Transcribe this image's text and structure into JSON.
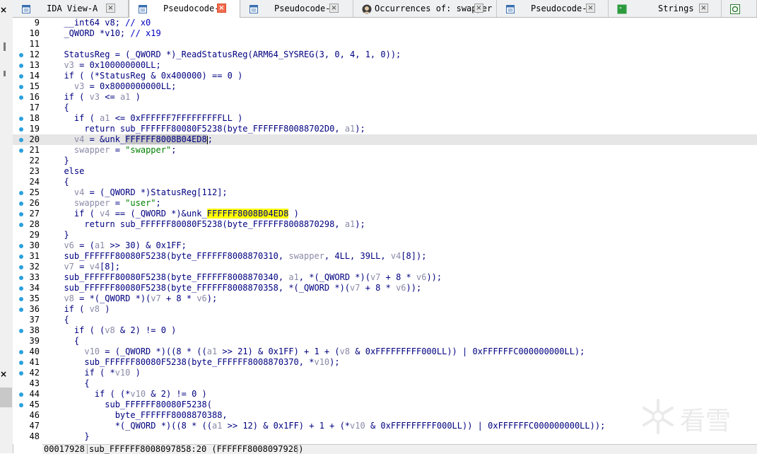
{
  "tabs": [
    {
      "label": "IDA View-A",
      "icon": "text-view-icon",
      "active": false
    },
    {
      "label": "Pseudocode-C",
      "icon": "pseudocode-icon",
      "active": true
    },
    {
      "label": "Pseudocode-B",
      "icon": "pseudocode-icon",
      "active": false
    },
    {
      "label": "Occurrences of: swapper",
      "icon": "avatar-icon",
      "active": false
    },
    {
      "label": "Pseudocode-A",
      "icon": "pseudocode-icon",
      "active": false
    },
    {
      "label": "Strings",
      "icon": "strings-icon",
      "active": false
    },
    {
      "label": "",
      "icon": "function-icon",
      "active": false
    }
  ],
  "close_glyph": "×",
  "code_lines": [
    {
      "n": "9",
      "dot": false,
      "parts": [
        [
          "t",
          "  __int64 v8; "
        ],
        [
          "cmt",
          "// x0"
        ]
      ]
    },
    {
      "n": "10",
      "dot": false,
      "parts": [
        [
          "t",
          "  _QWORD *v10; "
        ],
        [
          "cmt",
          "// x19"
        ]
      ]
    },
    {
      "n": "11",
      "dot": false,
      "parts": []
    },
    {
      "n": "12",
      "dot": true,
      "parts": [
        [
          "t",
          "  StatusReg = (_QWORD *)_ReadStatusReg(ARM64_SYSREG(3, 0, 4, 1, 0));"
        ]
      ]
    },
    {
      "n": "13",
      "dot": true,
      "parts": [
        [
          "var",
          "  v3"
        ],
        [
          "t",
          " = 0x100000000LL;"
        ]
      ]
    },
    {
      "n": "14",
      "dot": true,
      "parts": [
        [
          "t",
          "  if ( (*StatusReg & 0x400000) == 0 )"
        ]
      ]
    },
    {
      "n": "15",
      "dot": true,
      "parts": [
        [
          "var",
          "    v3"
        ],
        [
          "t",
          " = 0x8000000000LL;"
        ]
      ]
    },
    {
      "n": "16",
      "dot": true,
      "parts": [
        [
          "t",
          "  if ( "
        ],
        [
          "var",
          "v3"
        ],
        [
          "t",
          " <= "
        ],
        [
          "var",
          "a1"
        ],
        [
          "t",
          " )"
        ]
      ]
    },
    {
      "n": "17",
      "dot": false,
      "parts": [
        [
          "t",
          "  {"
        ]
      ]
    },
    {
      "n": "18",
      "dot": true,
      "parts": [
        [
          "t",
          "    if ( "
        ],
        [
          "var",
          "a1"
        ],
        [
          "t",
          " <= 0xFFFFFF7FFFFFFFFFLL )"
        ]
      ]
    },
    {
      "n": "19",
      "dot": true,
      "parts": [
        [
          "t",
          "      return sub_FFFFFF80080F5238(byte_FFFFFF80088702D0, "
        ],
        [
          "var",
          "a1"
        ],
        [
          "t",
          ");"
        ]
      ]
    },
    {
      "n": "20",
      "dot": true,
      "cur": true,
      "parts": [
        [
          "var",
          "    v4"
        ],
        [
          "t",
          " = &unk_"
        ],
        [
          "sel",
          "FFFFFF8008B04ED8"
        ],
        [
          "caret",
          ""
        ],
        [
          "t",
          ";"
        ]
      ]
    },
    {
      "n": "21",
      "dot": true,
      "parts": [
        [
          "var",
          "    swapper"
        ],
        [
          "t",
          " = "
        ],
        [
          "str",
          "\"swapper\""
        ],
        [
          "t",
          ";"
        ]
      ]
    },
    {
      "n": "22",
      "dot": false,
      "parts": [
        [
          "t",
          "  }"
        ]
      ]
    },
    {
      "n": "23",
      "dot": false,
      "parts": [
        [
          "t",
          "  else"
        ]
      ]
    },
    {
      "n": "24",
      "dot": false,
      "parts": [
        [
          "t",
          "  {"
        ]
      ]
    },
    {
      "n": "25",
      "dot": true,
      "parts": [
        [
          "var",
          "    v4"
        ],
        [
          "t",
          " = (_QWORD *)StatusReg[112];"
        ]
      ]
    },
    {
      "n": "26",
      "dot": true,
      "parts": [
        [
          "var",
          "    swapper"
        ],
        [
          "t",
          " = "
        ],
        [
          "str",
          "\"user\""
        ],
        [
          "t",
          ";"
        ]
      ]
    },
    {
      "n": "27",
      "dot": true,
      "parts": [
        [
          "t",
          "    if ( "
        ],
        [
          "var",
          "v4"
        ],
        [
          "t",
          " == (_QWORD *)&unk_"
        ],
        [
          "hl",
          "FFFFFF8008B04ED8"
        ],
        [
          "t",
          " )"
        ]
      ]
    },
    {
      "n": "28",
      "dot": true,
      "parts": [
        [
          "t",
          "      return sub_FFFFFF80080F5238(byte_FFFFFF8008870298, "
        ],
        [
          "var",
          "a1"
        ],
        [
          "t",
          ");"
        ]
      ]
    },
    {
      "n": "29",
      "dot": false,
      "parts": [
        [
          "t",
          "  }"
        ]
      ]
    },
    {
      "n": "30",
      "dot": true,
      "parts": [
        [
          "var",
          "  v6"
        ],
        [
          "t",
          " = ("
        ],
        [
          "var",
          "a1"
        ],
        [
          "t",
          " >> 30) & 0x1FF;"
        ]
      ]
    },
    {
      "n": "31",
      "dot": true,
      "parts": [
        [
          "t",
          "  sub_FFFFFF80080F5238(byte_FFFFFF8008870310, "
        ],
        [
          "var",
          "swapper"
        ],
        [
          "t",
          ", 4LL, 39LL, "
        ],
        [
          "var",
          "v4"
        ],
        [
          "t",
          "[8]);"
        ]
      ]
    },
    {
      "n": "32",
      "dot": true,
      "parts": [
        [
          "var",
          "  v7"
        ],
        [
          "t",
          " = "
        ],
        [
          "var",
          "v4"
        ],
        [
          "t",
          "[8];"
        ]
      ]
    },
    {
      "n": "33",
      "dot": true,
      "parts": [
        [
          "t",
          "  sub_FFFFFF80080F5238(byte_FFFFFF8008870340, "
        ],
        [
          "var",
          "a1"
        ],
        [
          "t",
          ", *(_QWORD *)("
        ],
        [
          "var",
          "v7"
        ],
        [
          "t",
          " + 8 * "
        ],
        [
          "var",
          "v6"
        ],
        [
          "t",
          "));"
        ]
      ]
    },
    {
      "n": "34",
      "dot": true,
      "parts": [
        [
          "t",
          "  sub_FFFFFF80080F5238(byte_FFFFFF8008870358, *(_QWORD *)("
        ],
        [
          "var",
          "v7"
        ],
        [
          "t",
          " + 8 * "
        ],
        [
          "var",
          "v6"
        ],
        [
          "t",
          "));"
        ]
      ]
    },
    {
      "n": "35",
      "dot": true,
      "parts": [
        [
          "var",
          "  v8"
        ],
        [
          "t",
          " = *(_QWORD *)("
        ],
        [
          "var",
          "v7"
        ],
        [
          "t",
          " + 8 * "
        ],
        [
          "var",
          "v6"
        ],
        [
          "t",
          ");"
        ]
      ]
    },
    {
      "n": "36",
      "dot": true,
      "parts": [
        [
          "t",
          "  if ( "
        ],
        [
          "var",
          "v8"
        ],
        [
          "t",
          " )"
        ]
      ]
    },
    {
      "n": "37",
      "dot": false,
      "parts": [
        [
          "t",
          "  {"
        ]
      ]
    },
    {
      "n": "38",
      "dot": true,
      "parts": [
        [
          "t",
          "    if ( ("
        ],
        [
          "var",
          "v8"
        ],
        [
          "t",
          " & 2) != 0 )"
        ]
      ]
    },
    {
      "n": "39",
      "dot": false,
      "parts": [
        [
          "t",
          "    {"
        ]
      ]
    },
    {
      "n": "40",
      "dot": true,
      "parts": [
        [
          "var",
          "      v10"
        ],
        [
          "t",
          " = (_QWORD *)((8 * (("
        ],
        [
          "var",
          "a1"
        ],
        [
          "t",
          " >> 21) & 0x1FF) + 1 + ("
        ],
        [
          "var",
          "v8"
        ],
        [
          "t",
          " & 0xFFFFFFFFF000LL)) | 0xFFFFFFC000000000LL);"
        ]
      ]
    },
    {
      "n": "41",
      "dot": true,
      "parts": [
        [
          "t",
          "      sub_FFFFFF80080F5238(byte_FFFFFF8008870370, *"
        ],
        [
          "var",
          "v10"
        ],
        [
          "t",
          ");"
        ]
      ]
    },
    {
      "n": "42",
      "dot": true,
      "parts": [
        [
          "t",
          "      if ( *"
        ],
        [
          "var",
          "v10"
        ],
        [
          "t",
          " )"
        ]
      ]
    },
    {
      "n": "43",
      "dot": false,
      "parts": [
        [
          "t",
          "      {"
        ]
      ]
    },
    {
      "n": "44",
      "dot": true,
      "parts": [
        [
          "t",
          "        if ( (*"
        ],
        [
          "var",
          "v10"
        ],
        [
          "t",
          " & 2) != 0 )"
        ]
      ]
    },
    {
      "n": "45",
      "dot": true,
      "parts": [
        [
          "t",
          "          sub_FFFFFF80080F5238("
        ]
      ]
    },
    {
      "n": "46",
      "dot": false,
      "parts": [
        [
          "t",
          "            byte_FFFFFF8008870388,"
        ]
      ]
    },
    {
      "n": "47",
      "dot": false,
      "parts": [
        [
          "t",
          "            *(_QWORD *)((8 * (("
        ],
        [
          "var",
          "a1"
        ],
        [
          "t",
          " >> 12) & 0x1FF) + 1 + (*"
        ],
        [
          "var",
          "v10"
        ],
        [
          "t",
          " & 0xFFFFFFFFF000LL)) | 0xFFFFFFC000000000LL));"
        ]
      ]
    },
    {
      "n": "48",
      "dot": false,
      "parts": [
        [
          "t",
          "      }"
        ]
      ]
    }
  ],
  "status": {
    "address": "00017928",
    "location": "sub_FFFFFF8008097858:20 (FFFFFF8008097928)"
  },
  "watermark": {
    "icon": "snowflake-logo-icon",
    "text": "看雪"
  }
}
